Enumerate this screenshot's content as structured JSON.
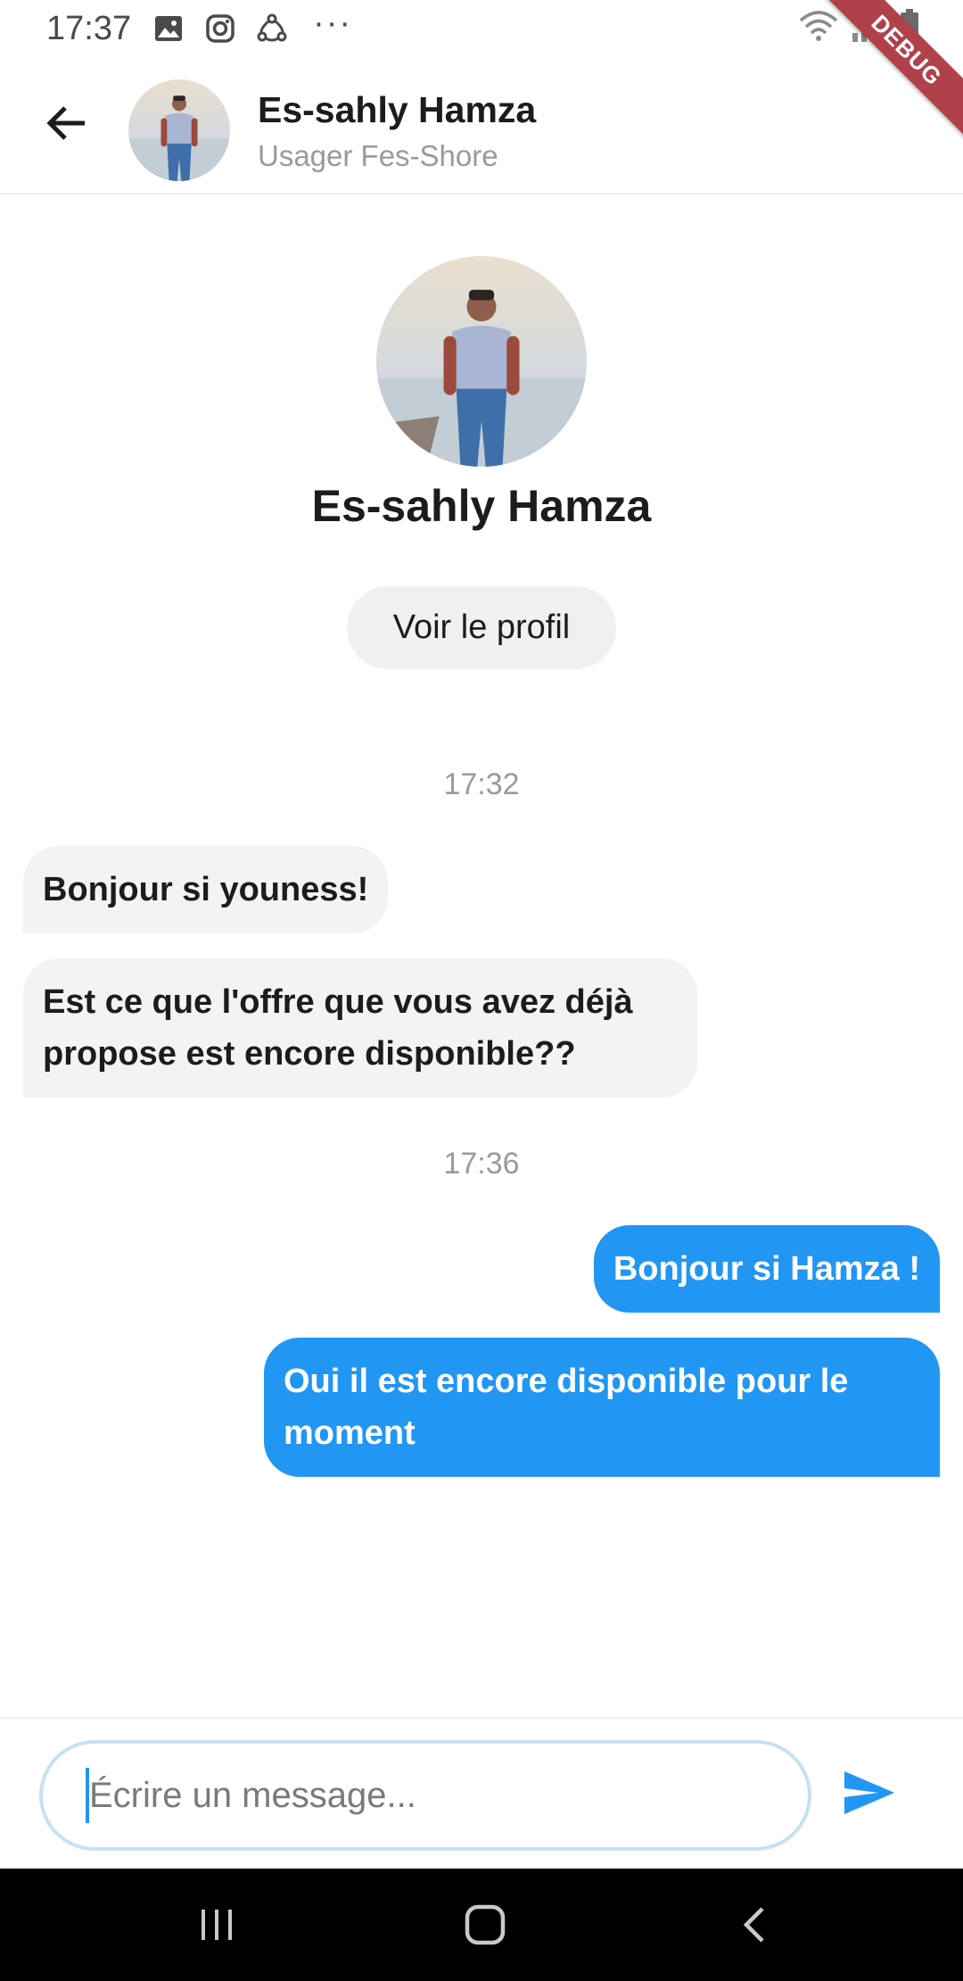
{
  "status_bar": {
    "time": "17:37",
    "icons": [
      "image-icon",
      "instagram-icon",
      "share-icon",
      "wifi-icon",
      "signal-icon",
      "battery-icon"
    ],
    "more": "···",
    "debug_label": "DEBUG"
  },
  "header": {
    "name": "Es-sahly Hamza",
    "subtitle": "Usager Fes-Shore"
  },
  "profile": {
    "name": "Es-sahly Hamza",
    "view_profile_label": "Voir le profil"
  },
  "messages": [
    {
      "type": "timestamp",
      "text": "17:32"
    },
    {
      "type": "incoming",
      "text": "Bonjour si youness!"
    },
    {
      "type": "incoming",
      "text": "Est ce que l'offre que vous avez déjà propose est encore disponible??"
    },
    {
      "type": "timestamp",
      "text": "17:36"
    },
    {
      "type": "outgoing",
      "text": "Bonjour si Hamza !"
    },
    {
      "type": "outgoing",
      "text": "Oui il est encore disponible pour le moment"
    }
  ],
  "composer": {
    "placeholder": "Écrire un message...",
    "value": ""
  },
  "colors": {
    "accent": "#2196f3",
    "incoming_bubble": "#f3f3f3",
    "debug_ribbon": "#b0414a"
  }
}
